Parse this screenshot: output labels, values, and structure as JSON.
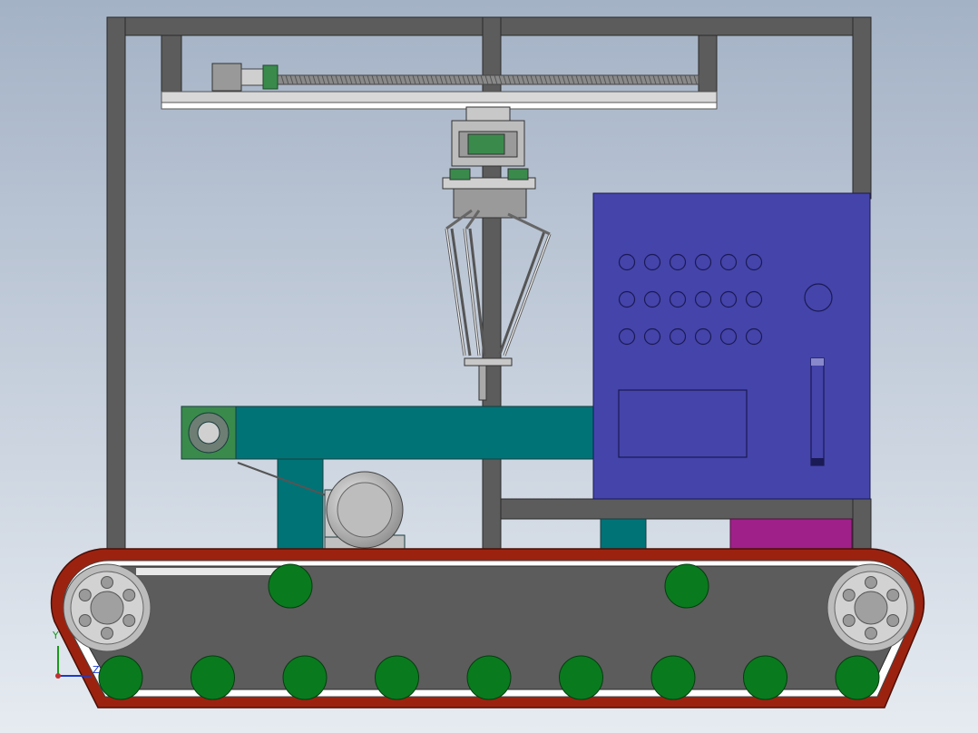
{
  "colors": {
    "bg_top": "#a4b2c6",
    "bg_bottom": "#e6ebf1",
    "frame": "#5c5c5c",
    "frame_edge": "#2a2a2a",
    "conveyor": "#007377",
    "cabinet": "#4444aa",
    "cabinet_outline": "#1a1a55",
    "track": "#9c2210",
    "roller": "#0a7a1e",
    "wheel": "#b8b8b8",
    "magenta_box": "#a0208a",
    "motor_body": "#c8c8c8",
    "bearing_green": "#3a8a4c"
  },
  "axis_triad": {
    "y_label": "Y",
    "z_label": "Z"
  },
  "parts": {
    "frame": "frame-icon",
    "linear_rail": "rail-icon",
    "delta_robot": "robot-icon",
    "conveyor": "conveyor-icon",
    "control_cabinet": "cabinet-icon",
    "crawler_track": "track-icon"
  },
  "counts": {
    "bottom_rollers": 9,
    "top_rollers": 2,
    "cabinet_button_rows": 3,
    "cabinet_button_cols": 6
  }
}
